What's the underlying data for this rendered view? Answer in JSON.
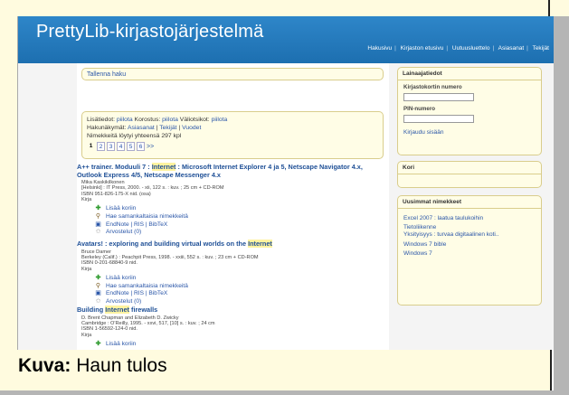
{
  "app": {
    "title": "PrettyLib-kirjastojärjestelmä"
  },
  "topnav": {
    "items": [
      "Hakusivu",
      "Kirjaston etusivu",
      "Uutuusluettelo",
      "Asiasanat",
      "Tekijät"
    ]
  },
  "search": {
    "save_label": "Tallenna haku",
    "options_prefix_1": "Lisätiedot:",
    "options_value_1": "piilota",
    "options_prefix_2": "Korostus:",
    "options_value_2": "piilota",
    "options_prefix_3": "Väliotsikot:",
    "options_value_3": "piilota",
    "search_type_prefix": "Hakunäkymät:",
    "search_types": [
      "Asiasanat",
      "Tekijät",
      "Vuodet"
    ],
    "results_text": "Nimekkeitä löytyi yhteensä 297 kpl",
    "current_page": "1",
    "pages": [
      "2",
      "3",
      "4",
      "5",
      "6"
    ],
    "next_label": ">>"
  },
  "results": [
    {
      "title_pre": "A++ trainer. Moduuli 7 : ",
      "title_hl": "Internet",
      "title_post": " : Microsoft Internet Explorer 4 ja 5, Netscape Navigator 4.x, Outlook Express 4/5, Netscape Messenger 4.x",
      "author": "Mika Kaskikilkonen",
      "pub": "[Helsinki] : IT Press, 2000. - xii, 122 s. : kuv. ; 25 cm + CD-ROM",
      "isbn": "ISBN 951-826-175-X nid. (osa)",
      "type": "Kirja"
    },
    {
      "title_pre": "Avatars! : exploring and building virtual worlds on the ",
      "title_hl": "Internet",
      "title_post": "",
      "author": "Bruce Damer",
      "pub": "Berkeley (Calif.) : Peachpit Press, 1998. - xxiii, 552 s. : kuv. ; 23 cm + CD-ROM",
      "isbn": "ISBN 0-201-68840-9 nid.",
      "type": "Kirja"
    },
    {
      "title_pre": "Building ",
      "title_hl": "Internet",
      "title_post": " firewalls",
      "author": "D. Brent Chapman and Elizabeth D. Zwicky",
      "pub": "Cambridge : O'Reilly, 1995. - xxvi, 517, [10] s. : kuv. ; 24 cm",
      "isbn": "ISBN 1-56592-124-0 nid.",
      "type": "Kirja"
    }
  ],
  "actions": {
    "add_cart": "Lisää koriin",
    "similar": "Hae samankaltaisia nimekkeitä",
    "export": "EndNote | RIS | BibTeX",
    "reviews": "Arvostelut (0)"
  },
  "sidebar": {
    "loan_title": "Lainaajatiedot",
    "card_label": "Kirjastokortin numero",
    "pin_label": "PIN-numero",
    "login_label": "Kirjaudu sisään",
    "cart_title": "Kori",
    "newest_title": "Uusimmat nimekkeet",
    "newest_items": [
      "Excel 2007 : laatua taulukoihin",
      "Tietoliikenne",
      "Yksityisyys : turvaa digitaalinen koti..",
      "Windows 7 bible",
      "Windows 7"
    ]
  },
  "caption": {
    "label": "Kuva:",
    "text": " Haun tulos"
  }
}
